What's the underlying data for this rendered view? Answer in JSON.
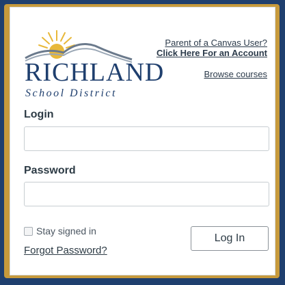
{
  "brand": {
    "name": "RICHLAND",
    "subtitle": "School District",
    "colors": {
      "navy": "#1f3f6e",
      "gold": "#c79a3c",
      "sun": "#e8b83a"
    }
  },
  "links": {
    "parent_question": "Parent of a Canvas User?",
    "create_account": "Click Here For an Account",
    "browse_courses": "Browse courses"
  },
  "form": {
    "login_label": "Login",
    "login_value": "",
    "password_label": "Password",
    "password_value": "",
    "stay_signed_in": "Stay signed in",
    "forgot_password": "Forgot Password?",
    "login_button": "Log In"
  }
}
